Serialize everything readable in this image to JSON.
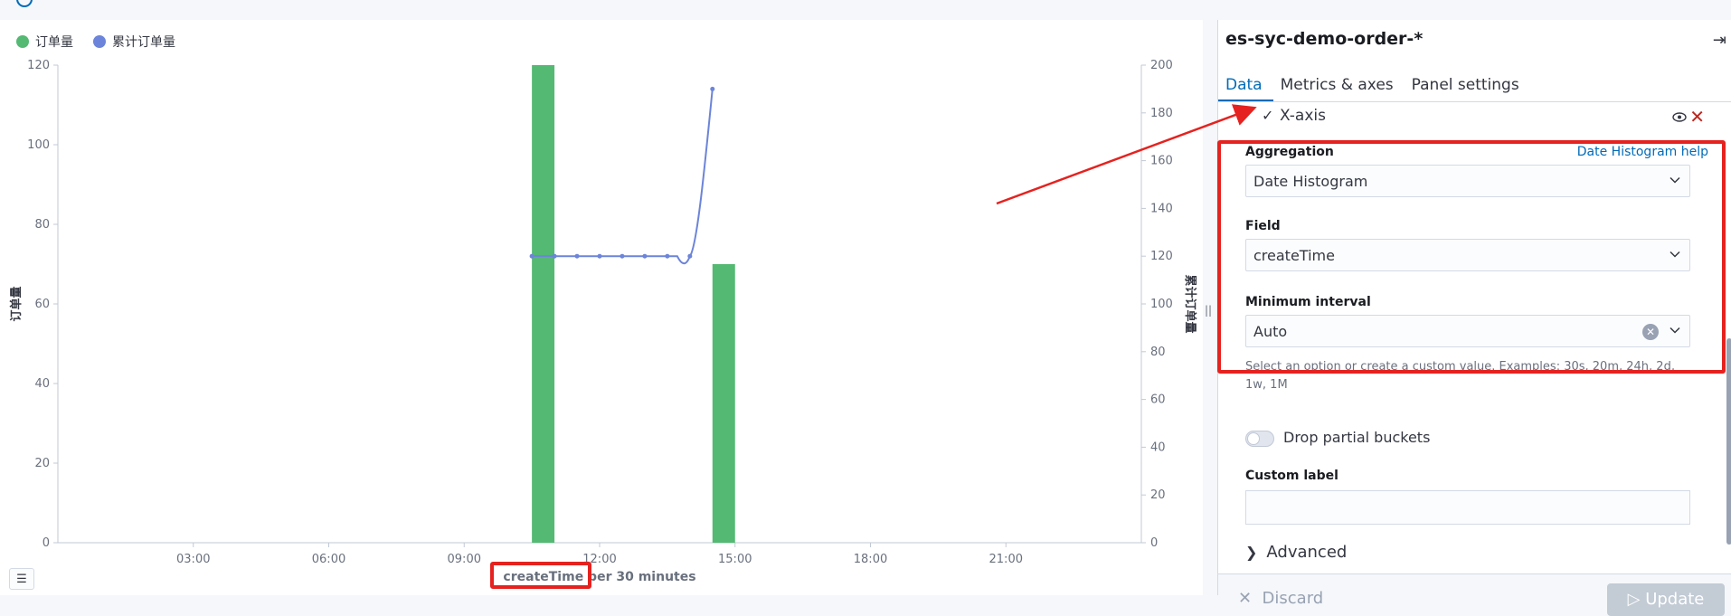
{
  "chart_data": {
    "type": "bar+line",
    "legend": [
      {
        "label": "订单量",
        "color": "#54b973"
      },
      {
        "label": "累计订单量",
        "color": "#6c84d9"
      }
    ],
    "x_ticks": [
      "03:00",
      "06:00",
      "09:00",
      "12:00",
      "15:00",
      "18:00",
      "21:00"
    ],
    "x_label": "createTime per 30 minutes",
    "y_left_label": "订单量",
    "y_right_label": "累计订单量",
    "y_left_ticks": [
      "0",
      "20",
      "40",
      "60",
      "80",
      "100",
      "120"
    ],
    "y_right_ticks": [
      "0",
      "20",
      "40",
      "60",
      "80",
      "100",
      "120",
      "140",
      "160",
      "180",
      "200"
    ],
    "y_left_range": [
      0,
      120
    ],
    "y_right_range": [
      0,
      200
    ],
    "x_range_hours": [
      0,
      24
    ],
    "bars": [
      {
        "x_hour": 10.75,
        "value": 120
      },
      {
        "x_hour": 14.75,
        "value": 70
      }
    ],
    "line": [
      {
        "x_hour": 10.5,
        "value": 120
      },
      {
        "x_hour": 11.0,
        "value": 120
      },
      {
        "x_hour": 11.5,
        "value": 120
      },
      {
        "x_hour": 12.0,
        "value": 120
      },
      {
        "x_hour": 12.5,
        "value": 120
      },
      {
        "x_hour": 13.0,
        "value": 120
      },
      {
        "x_hour": 13.5,
        "value": 120
      },
      {
        "x_hour": 14.0,
        "value": 120
      },
      {
        "x_hour": 14.5,
        "value": 190
      }
    ]
  },
  "editor": {
    "title": "es-syc-demo-order-*",
    "tabs": [
      "Data",
      "Metrics & axes",
      "Panel settings"
    ],
    "xaxis_label": "X-axis",
    "aggregation_label": "Aggregation",
    "aggregation_help": "Date Histogram help",
    "aggregation_value": "Date Histogram",
    "field_label": "Field",
    "field_value": "createTime",
    "interval_label": "Minimum interval",
    "interval_value": "Auto",
    "interval_hint": "Select an option or create a custom value. Examples: 30s, 20m, 24h, 2d, 1w, 1M",
    "drop_partial_label": "Drop partial buckets",
    "custom_label_label": "Custom label",
    "advanced_label": "Advanced",
    "discard_label": "Discard",
    "update_label": "Update"
  }
}
